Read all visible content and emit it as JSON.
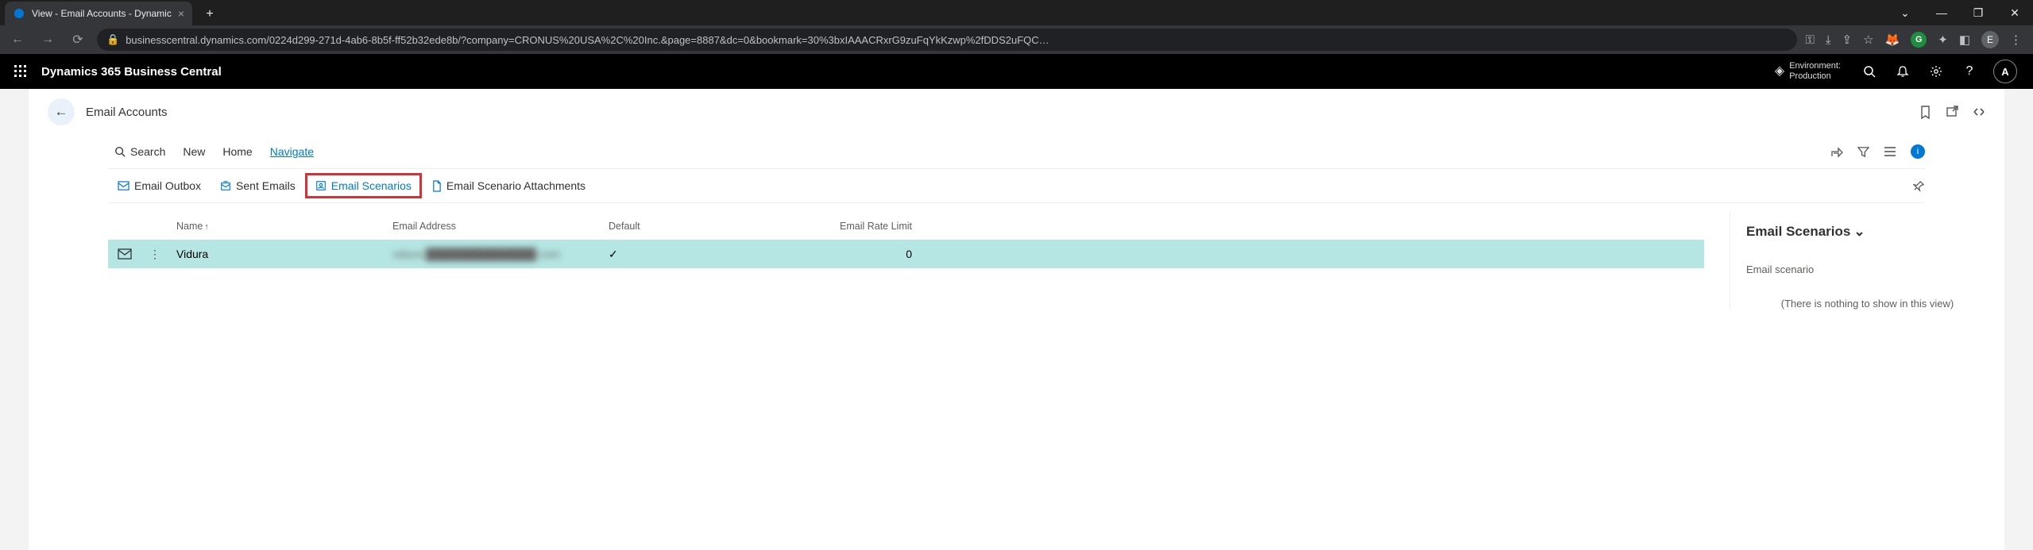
{
  "browser": {
    "tab_title": "View - Email Accounts - Dynamic",
    "url": "businesscentral.dynamics.com/0224d299-271d-4ab6-8b5f-ff52b32ede8b/?company=CRONUS%20USA%2C%20Inc.&page=8887&dc=0&bookmark=30%3bxIAAACRxrG9zuFqYkKzwp%2fDDS2uFQC…",
    "profile_letter": "E"
  },
  "app": {
    "title": "Dynamics 365 Business Central",
    "env_label": "Environment:",
    "env_value": "Production",
    "avatar_letter": "A"
  },
  "page": {
    "title": "Email Accounts"
  },
  "toolbar": {
    "search": "Search",
    "new": "New",
    "home": "Home",
    "navigate": "Navigate"
  },
  "subtoolbar": {
    "outbox": "Email Outbox",
    "sent": "Sent Emails",
    "scenarios": "Email Scenarios",
    "attachments": "Email Scenario Attachments"
  },
  "table": {
    "headers": {
      "name": "Name",
      "email": "Email Address",
      "default": "Default",
      "rate": "Email Rate Limit"
    },
    "rows": [
      {
        "name": "Vidura",
        "email_masked": "vidura.██████████████.com",
        "default": "✓",
        "rate": "0"
      }
    ]
  },
  "factbox": {
    "title": "Email Scenarios",
    "field_label": "Email scenario",
    "empty_msg": "(There is nothing to show in this view)"
  }
}
